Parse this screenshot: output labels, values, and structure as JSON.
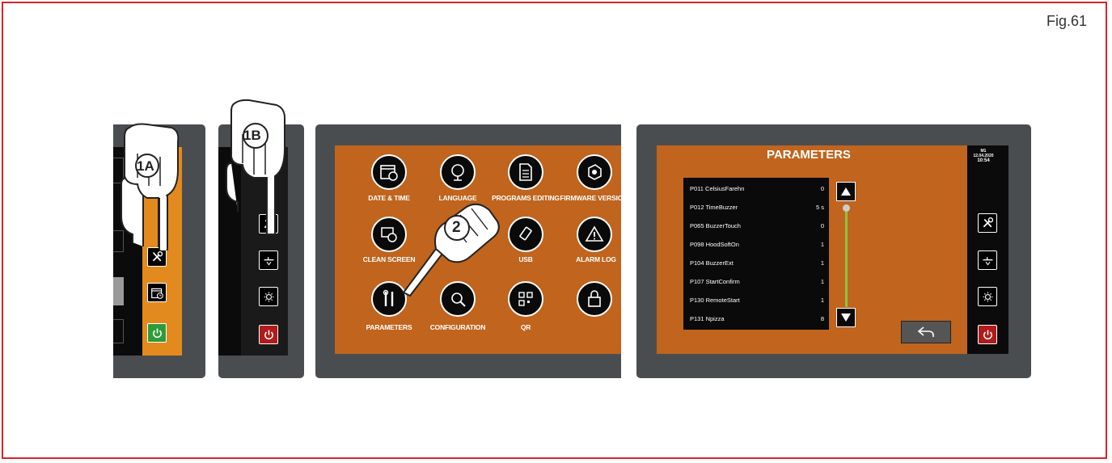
{
  "figure_label": "Fig.61",
  "step_labels": {
    "step_1a": "1A",
    "step_1b": "1B",
    "step_2": "2"
  },
  "menu": {
    "items": [
      {
        "label": "DATE & TIME",
        "icon": "calendar-icon"
      },
      {
        "label": "LANGUAGE",
        "icon": "globe-icon"
      },
      {
        "label": "PROGRAMS EDITING",
        "icon": "document-icon"
      },
      {
        "label": "FIRMWARE VERSIONS",
        "icon": "chip-icon"
      },
      {
        "label": "CLEAN SCREEN",
        "icon": "clean-screen-icon"
      },
      {
        "label": "USB",
        "icon": "usb-icon"
      },
      {
        "label": "ALARM LOG",
        "icon": "alarm-icon"
      },
      {
        "label": "PARAMETERS",
        "icon": "tools-icon"
      },
      {
        "label": "CONFIGURATION",
        "icon": "configuration-icon"
      },
      {
        "label": "QR",
        "icon": "qr-icon"
      },
      {
        "label": "",
        "icon": "lock-icon"
      }
    ]
  },
  "parameters_screen": {
    "title": "PARAMETERS",
    "header_info": {
      "line1": "M1",
      "line2": "12.04.2020",
      "line3": "10:54"
    },
    "rows": [
      {
        "name": "P011 CelsiusFarehn",
        "value": "0"
      },
      {
        "name": "P012 TimeBuzzer",
        "value": "5 s"
      },
      {
        "name": "P065 BuzzerTouch",
        "value": "0"
      },
      {
        "name": "P098 HoodSoftOn",
        "value": "1"
      },
      {
        "name": "P104 BuzzerExt",
        "value": "1"
      },
      {
        "name": "P107 StartConfirm",
        "value": "1"
      },
      {
        "name": "P130 RemoteStart",
        "value": "1"
      },
      {
        "name": "P131 Npizza",
        "value": "8"
      }
    ]
  },
  "colors": {
    "frame": "#d8232a",
    "panel": "#4a4d50",
    "screen_orange": "#c0641e",
    "slider_green": "#8bc43f",
    "power_red": "#b01b1b",
    "power_green": "#2e9b3a"
  }
}
